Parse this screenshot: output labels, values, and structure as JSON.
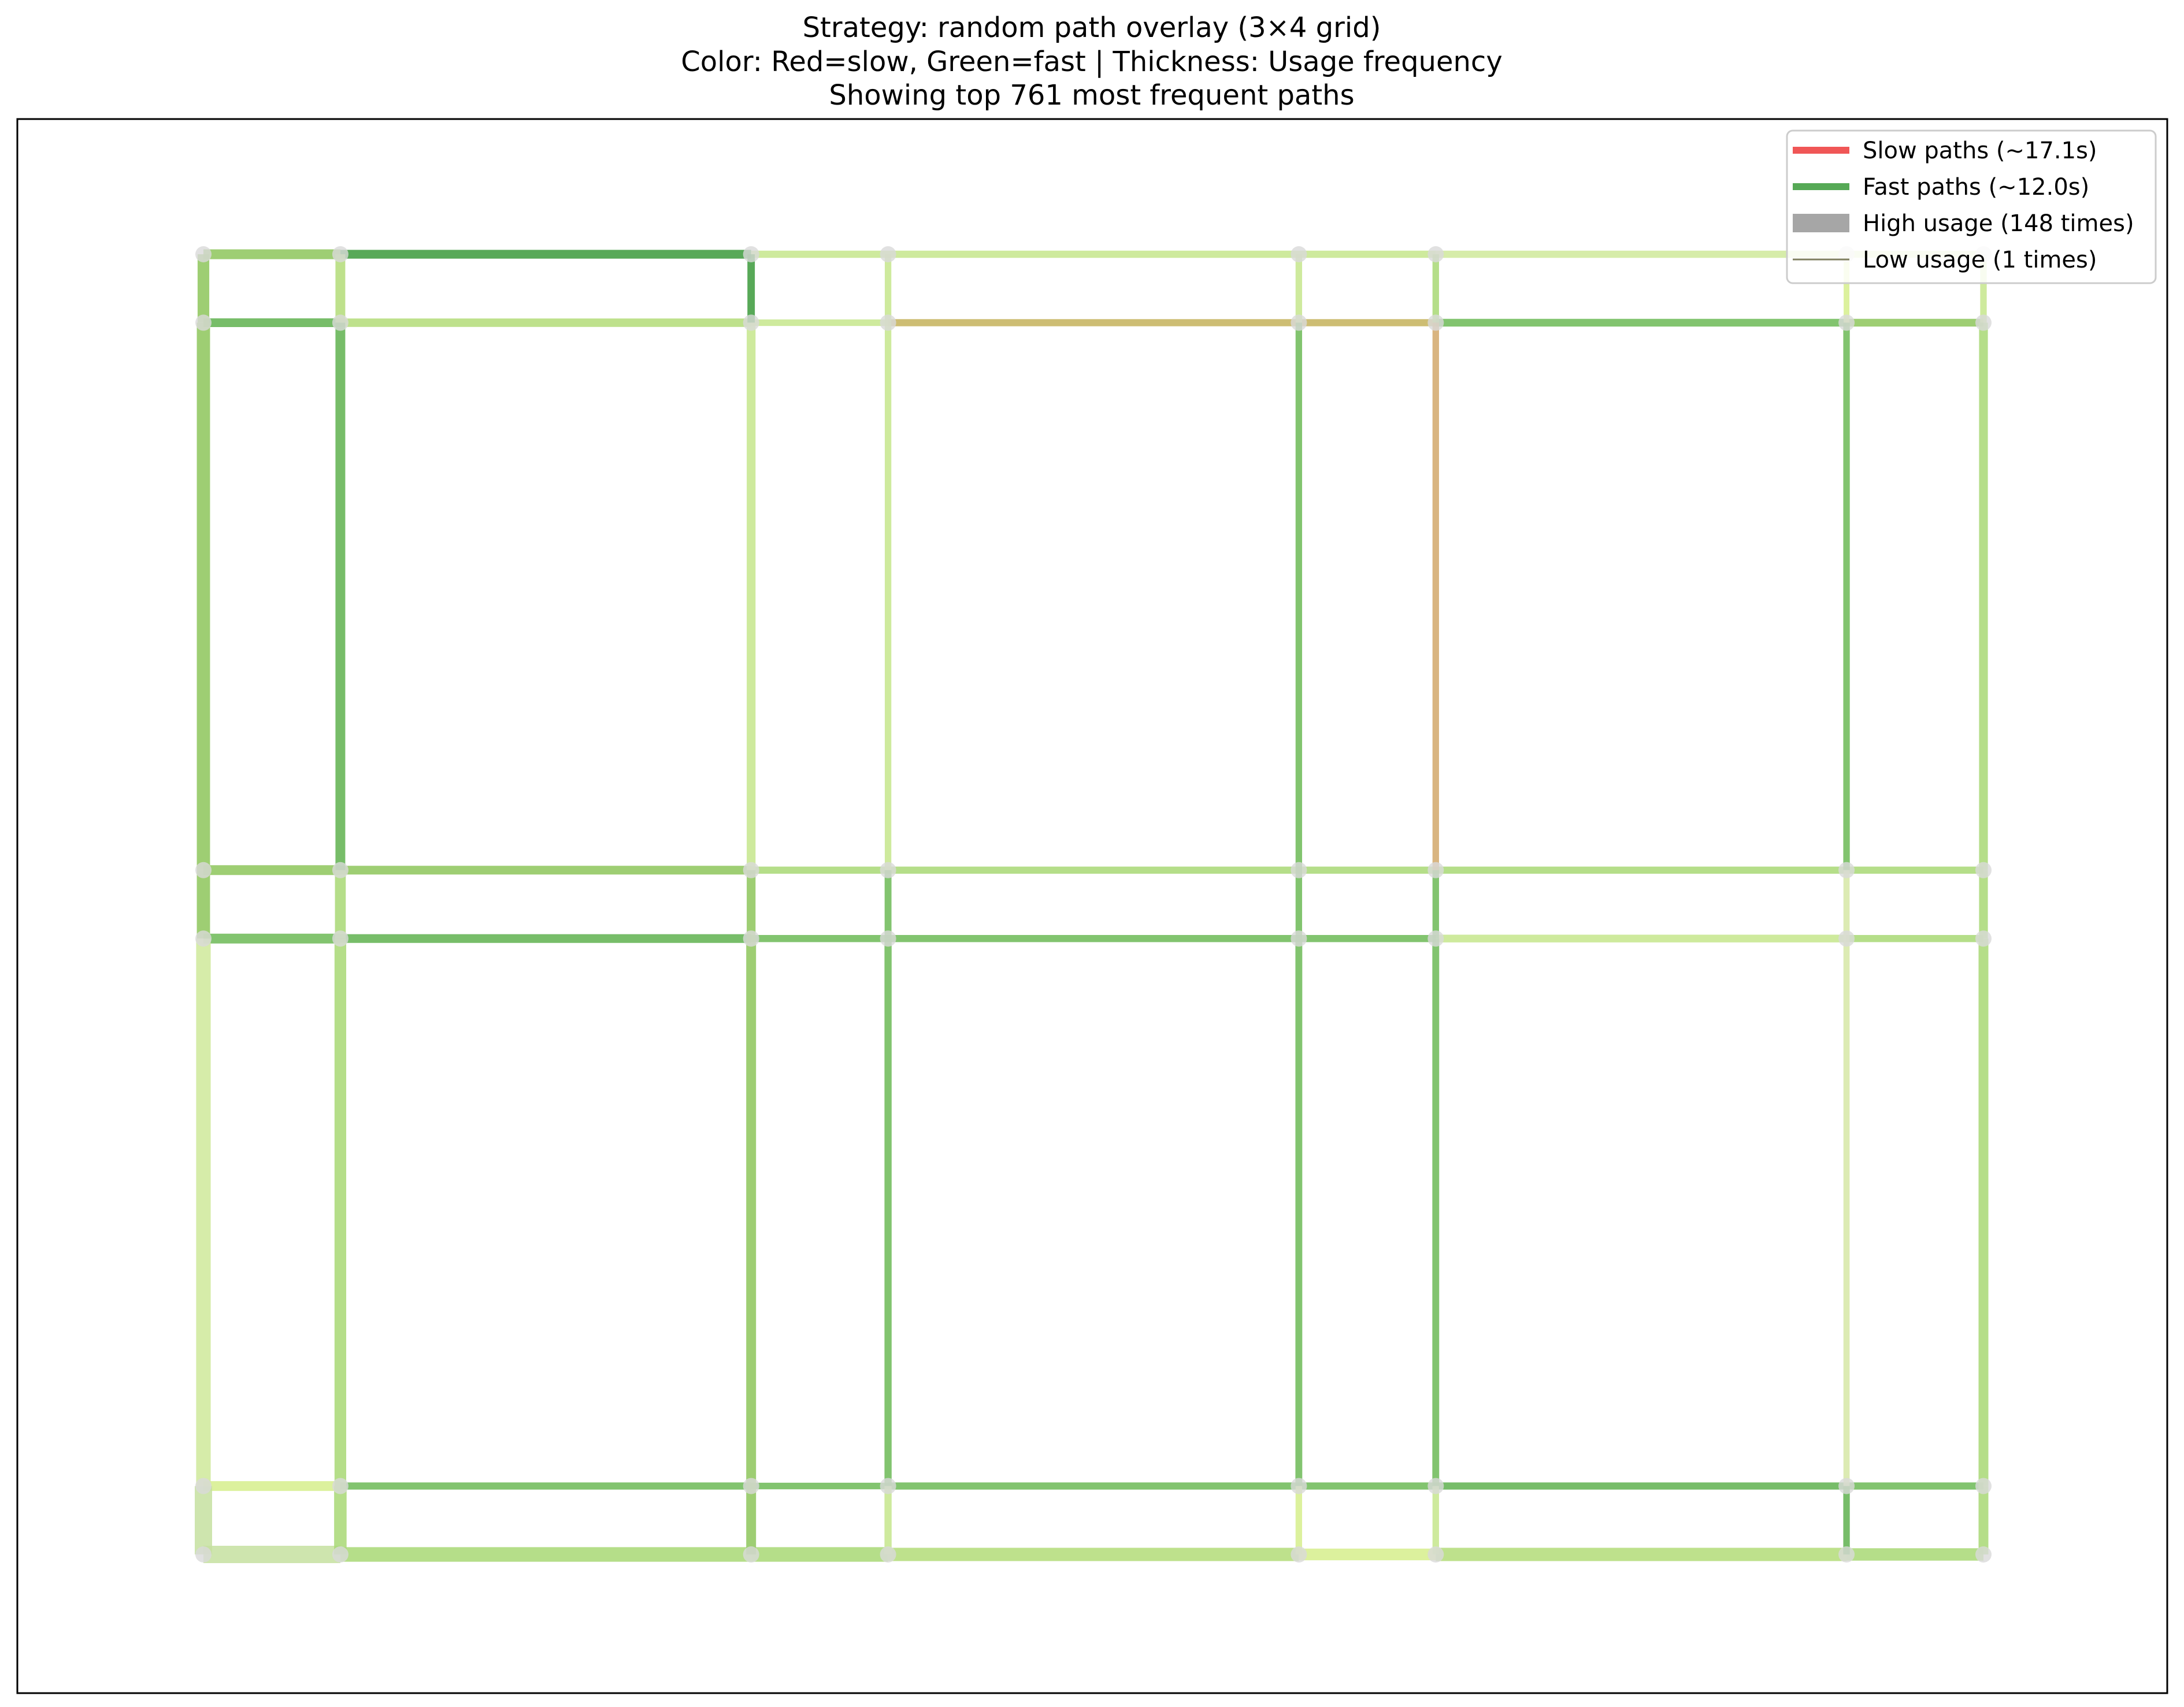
{
  "chart_data": {
    "type": "network",
    "title_lines": [
      "Strategy: random path overlay (3×4 grid)",
      "Color: Red=slow, Green=fast | Thickness: Usage frequency",
      "Showing top 761 most frequent paths"
    ],
    "xlabel": "",
    "ylabel": "",
    "axes_visible": false,
    "grid": false,
    "legend_position": "top-right",
    "legend": [
      {
        "label": "Slow paths (~17.1s)",
        "color": "#ee4444",
        "kind": "slow"
      },
      {
        "label": "Fast paths (~12.0s)",
        "color": "#44a044",
        "kind": "fast"
      },
      {
        "label": "High usage (148 times)",
        "color": "#a6a6a6",
        "kind": "high"
      },
      {
        "label": "Low usage (1 times)",
        "color": "#808060",
        "kind": "low"
      }
    ],
    "node_columns": [
      0,
      1,
      4,
      5,
      8,
      9,
      12,
      13
    ],
    "node_rows": [
      0,
      1,
      9,
      10,
      18,
      19
    ],
    "node_color": "#d9d9d9",
    "edges": [
      {
        "from": [
          0,
          0
        ],
        "to": [
          1,
          0
        ],
        "color": "#8dc65a",
        "usage": 40
      },
      {
        "from": [
          1,
          0
        ],
        "to": [
          4,
          0
        ],
        "color": "#3b9a3b",
        "usage": 30
      },
      {
        "from": [
          4,
          0
        ],
        "to": [
          5,
          0
        ],
        "color": "#c6e68c",
        "usage": 18
      },
      {
        "from": [
          5,
          0
        ],
        "to": [
          8,
          0
        ],
        "color": "#c6e68c",
        "usage": 18
      },
      {
        "from": [
          8,
          0
        ],
        "to": [
          9,
          0
        ],
        "color": "#c6e68c",
        "usage": 18
      },
      {
        "from": [
          9,
          0
        ],
        "to": [
          12,
          0
        ],
        "color": "#cfe99a",
        "usage": 18
      },
      {
        "from": [
          12,
          0
        ],
        "to": [
          13,
          0
        ],
        "color": "#cfe99a",
        "usage": 16
      },
      {
        "from": [
          0,
          1
        ],
        "to": [
          1,
          1
        ],
        "color": "#5fb24f",
        "usage": 30
      },
      {
        "from": [
          1,
          1
        ],
        "to": [
          4,
          1
        ],
        "color": "#b3dc78",
        "usage": 28
      },
      {
        "from": [
          4,
          1
        ],
        "to": [
          5,
          1
        ],
        "color": "#c6e68c",
        "usage": 14
      },
      {
        "from": [
          5,
          1
        ],
        "to": [
          8,
          1
        ],
        "color": "#c4b25a",
        "usage": 18
      },
      {
        "from": [
          8,
          1
        ],
        "to": [
          9,
          1
        ],
        "color": "#c4b25a",
        "usage": 18
      },
      {
        "from": [
          9,
          1
        ],
        "to": [
          12,
          1
        ],
        "color": "#6cba56",
        "usage": 22
      },
      {
        "from": [
          12,
          1
        ],
        "to": [
          13,
          1
        ],
        "color": "#8dc65a",
        "usage": 22
      },
      {
        "from": [
          0,
          9
        ],
        "to": [
          1,
          9
        ],
        "color": "#8dc65a",
        "usage": 40
      },
      {
        "from": [
          1,
          9
        ],
        "to": [
          4,
          9
        ],
        "color": "#8dc65a",
        "usage": 30
      },
      {
        "from": [
          4,
          9
        ],
        "to": [
          5,
          9
        ],
        "color": "#a8d874",
        "usage": 18
      },
      {
        "from": [
          5,
          9
        ],
        "to": [
          8,
          9
        ],
        "color": "#a8d874",
        "usage": 18
      },
      {
        "from": [
          8,
          9
        ],
        "to": [
          9,
          9
        ],
        "color": "#a8d874",
        "usage": 18
      },
      {
        "from": [
          9,
          9
        ],
        "to": [
          12,
          9
        ],
        "color": "#a8d874",
        "usage": 18
      },
      {
        "from": [
          12,
          9
        ],
        "to": [
          13,
          9
        ],
        "color": "#a8d874",
        "usage": 18
      },
      {
        "from": [
          0,
          10
        ],
        "to": [
          1,
          10
        ],
        "color": "#6cba56",
        "usage": 40
      },
      {
        "from": [
          1,
          10
        ],
        "to": [
          4,
          10
        ],
        "color": "#5fb24f",
        "usage": 30
      },
      {
        "from": [
          4,
          10
        ],
        "to": [
          5,
          10
        ],
        "color": "#6cba56",
        "usage": 18
      },
      {
        "from": [
          5,
          10
        ],
        "to": [
          8,
          10
        ],
        "color": "#6cba56",
        "usage": 18
      },
      {
        "from": [
          8,
          10
        ],
        "to": [
          9,
          10
        ],
        "color": "#6cba56",
        "usage": 18
      },
      {
        "from": [
          9,
          10
        ],
        "to": [
          12,
          10
        ],
        "color": "#c6e68c",
        "usage": 22
      },
      {
        "from": [
          12,
          10
        ],
        "to": [
          13,
          10
        ],
        "color": "#a8d874",
        "usage": 18
      },
      {
        "from": [
          0,
          18
        ],
        "to": [
          1,
          18
        ],
        "color": "#d6ee8c",
        "usage": 40
      },
      {
        "from": [
          1,
          18
        ],
        "to": [
          4,
          18
        ],
        "color": "#6cba56",
        "usage": 18
      },
      {
        "from": [
          4,
          18
        ],
        "to": [
          5,
          18
        ],
        "color": "#6cba56",
        "usage": 14
      },
      {
        "from": [
          5,
          18
        ],
        "to": [
          8,
          18
        ],
        "color": "#6cba56",
        "usage": 18
      },
      {
        "from": [
          8,
          18
        ],
        "to": [
          9,
          18
        ],
        "color": "#6cba56",
        "usage": 18
      },
      {
        "from": [
          9,
          18
        ],
        "to": [
          12,
          18
        ],
        "color": "#5fb24f",
        "usage": 18
      },
      {
        "from": [
          12,
          18
        ],
        "to": [
          13,
          18
        ],
        "color": "#6cba56",
        "usage": 18
      },
      {
        "from": [
          0,
          19
        ],
        "to": [
          1,
          19
        ],
        "color": "#c6e0a0",
        "usage": 148
      },
      {
        "from": [
          1,
          19
        ],
        "to": [
          4,
          19
        ],
        "color": "#a8d874",
        "usage": 100
      },
      {
        "from": [
          4,
          19
        ],
        "to": [
          5,
          19
        ],
        "color": "#a8d874",
        "usage": 100
      },
      {
        "from": [
          5,
          19
        ],
        "to": [
          8,
          19
        ],
        "color": "#b3dc78",
        "usage": 80
      },
      {
        "from": [
          8,
          19
        ],
        "to": [
          9,
          19
        ],
        "color": "#d6ee8c",
        "usage": 60
      },
      {
        "from": [
          9,
          19
        ],
        "to": [
          12,
          19
        ],
        "color": "#b3dc78",
        "usage": 80
      },
      {
        "from": [
          12,
          19
        ],
        "to": [
          13,
          19
        ],
        "color": "#a8d874",
        "usage": 70
      },
      {
        "from": [
          0,
          0
        ],
        "to": [
          0,
          1
        ],
        "color": "#8dc65a",
        "usage": 60
      },
      {
        "from": [
          0,
          1
        ],
        "to": [
          0,
          9
        ],
        "color": "#8dc65a",
        "usage": 80
      },
      {
        "from": [
          0,
          9
        ],
        "to": [
          0,
          10
        ],
        "color": "#8dc65a",
        "usage": 80
      },
      {
        "from": [
          0,
          10
        ],
        "to": [
          0,
          18
        ],
        "color": "#cfe99a",
        "usage": 100
      },
      {
        "from": [
          0,
          18
        ],
        "to": [
          0,
          19
        ],
        "color": "#c6e0a0",
        "usage": 148
      },
      {
        "from": [
          1,
          0
        ],
        "to": [
          1,
          1
        ],
        "color": "#b3dc78",
        "usage": 40
      },
      {
        "from": [
          1,
          1
        ],
        "to": [
          1,
          9
        ],
        "color": "#5fb24f",
        "usage": 40
      },
      {
        "from": [
          1,
          9
        ],
        "to": [
          1,
          10
        ],
        "color": "#a8d874",
        "usage": 50
      },
      {
        "from": [
          1,
          10
        ],
        "to": [
          1,
          18
        ],
        "color": "#a8d874",
        "usage": 60
      },
      {
        "from": [
          1,
          18
        ],
        "to": [
          1,
          19
        ],
        "color": "#a8d874",
        "usage": 70
      },
      {
        "from": [
          4,
          0
        ],
        "to": [
          4,
          1
        ],
        "color": "#3b9a3b",
        "usage": 20
      },
      {
        "from": [
          4,
          1
        ],
        "to": [
          4,
          9
        ],
        "color": "#c6e68c",
        "usage": 30
      },
      {
        "from": [
          4,
          9
        ],
        "to": [
          4,
          10
        ],
        "color": "#8dc65a",
        "usage": 30
      },
      {
        "from": [
          4,
          10
        ],
        "to": [
          4,
          18
        ],
        "color": "#8dc65a",
        "usage": 40
      },
      {
        "from": [
          4,
          18
        ],
        "to": [
          4,
          19
        ],
        "color": "#8dc65a",
        "usage": 40
      },
      {
        "from": [
          5,
          0
        ],
        "to": [
          5,
          1
        ],
        "color": "#c6e68c",
        "usage": 14
      },
      {
        "from": [
          5,
          1
        ],
        "to": [
          5,
          9
        ],
        "color": "#c6e68c",
        "usage": 14
      },
      {
        "from": [
          5,
          9
        ],
        "to": [
          5,
          10
        ],
        "color": "#6cba56",
        "usage": 16
      },
      {
        "from": [
          5,
          10
        ],
        "to": [
          5,
          18
        ],
        "color": "#6cba56",
        "usage": 18
      },
      {
        "from": [
          5,
          18
        ],
        "to": [
          5,
          19
        ],
        "color": "#c6e68c",
        "usage": 18
      },
      {
        "from": [
          8,
          0
        ],
        "to": [
          8,
          1
        ],
        "color": "#c6e68c",
        "usage": 14
      },
      {
        "from": [
          8,
          1
        ],
        "to": [
          8,
          9
        ],
        "color": "#6cba56",
        "usage": 14
      },
      {
        "from": [
          8,
          9
        ],
        "to": [
          8,
          10
        ],
        "color": "#6cba56",
        "usage": 14
      },
      {
        "from": [
          8,
          10
        ],
        "to": [
          8,
          18
        ],
        "color": "#6cba56",
        "usage": 16
      },
      {
        "from": [
          8,
          18
        ],
        "to": [
          8,
          19
        ],
        "color": "#d6ee8c",
        "usage": 14
      },
      {
        "from": [
          9,
          0
        ],
        "to": [
          9,
          1
        ],
        "color": "#a8d874",
        "usage": 14
      },
      {
        "from": [
          9,
          1
        ],
        "to": [
          9,
          9
        ],
        "color": "#d2a86a",
        "usage": 14
      },
      {
        "from": [
          9,
          9
        ],
        "to": [
          9,
          10
        ],
        "color": "#6cba56",
        "usage": 14
      },
      {
        "from": [
          9,
          10
        ],
        "to": [
          9,
          18
        ],
        "color": "#6cba56",
        "usage": 16
      },
      {
        "from": [
          9,
          18
        ],
        "to": [
          9,
          19
        ],
        "color": "#c6e68c",
        "usage": 14
      },
      {
        "from": [
          12,
          0
        ],
        "to": [
          12,
          1
        ],
        "color": "#d6ee8c",
        "usage": 10
      },
      {
        "from": [
          12,
          1
        ],
        "to": [
          12,
          9
        ],
        "color": "#6cba56",
        "usage": 14
      },
      {
        "from": [
          12,
          9
        ],
        "to": [
          12,
          10
        ],
        "color": "#d6e8a6",
        "usage": 12
      },
      {
        "from": [
          12,
          10
        ],
        "to": [
          12,
          18
        ],
        "color": "#d6e8a6",
        "usage": 12
      },
      {
        "from": [
          12,
          18
        ],
        "to": [
          12,
          19
        ],
        "color": "#5fb24f",
        "usage": 14
      },
      {
        "from": [
          13,
          0
        ],
        "to": [
          13,
          1
        ],
        "color": "#c6e68c",
        "usage": 14
      },
      {
        "from": [
          13,
          1
        ],
        "to": [
          13,
          9
        ],
        "color": "#a8d874",
        "usage": 30
      },
      {
        "from": [
          13,
          9
        ],
        "to": [
          13,
          10
        ],
        "color": "#a8d874",
        "usage": 30
      },
      {
        "from": [
          13,
          10
        ],
        "to": [
          13,
          18
        ],
        "color": "#a8d874",
        "usage": 40
      },
      {
        "from": [
          13,
          18
        ],
        "to": [
          13,
          19
        ],
        "color": "#a8d874",
        "usage": 40
      }
    ]
  }
}
